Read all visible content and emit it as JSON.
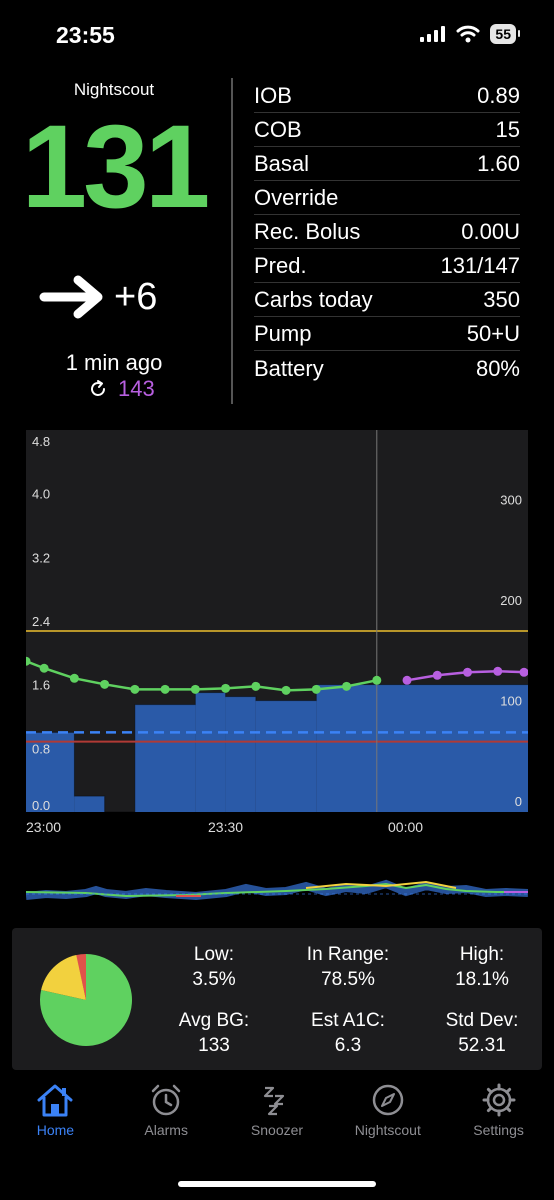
{
  "status_bar": {
    "time": "23:55",
    "battery": "55"
  },
  "glucose": {
    "app_name": "Nightscout",
    "value": "131",
    "delta": "+6",
    "age": "1 min ago",
    "predicted": "143",
    "color": "#5fd160",
    "predicted_color": "#b85fe0"
  },
  "info": {
    "rows": [
      {
        "label": "IOB",
        "value": "0.89"
      },
      {
        "label": "COB",
        "value": "15"
      },
      {
        "label": "Basal",
        "value": "1.60"
      },
      {
        "label": "Override",
        "value": ""
      },
      {
        "label": "Rec. Bolus",
        "value": "0.00U"
      },
      {
        "label": "Pred.",
        "value": "131/147"
      },
      {
        "label": "Carbs today",
        "value": "350"
      },
      {
        "label": "Pump",
        "value": "50+U"
      },
      {
        "label": "Battery",
        "value": "80%"
      }
    ]
  },
  "chart_data": {
    "type": "line",
    "left_axis_ticks": [
      "4.8",
      "4.0",
      "3.2",
      "2.4",
      "1.6",
      "0.8",
      "0.0"
    ],
    "right_axis_ticks": [
      "300",
      "200",
      "100",
      "0"
    ],
    "x_ticks": [
      "23:00",
      "23:30",
      "00:00"
    ],
    "left_ylim": [
      0,
      4.8
    ],
    "right_ylim": [
      0,
      380
    ],
    "high_line": 180,
    "low_line": 70,
    "scheduled_basal": 1.0,
    "now_minute": 58,
    "bg_series": {
      "color": "#5fd160",
      "x_min": [
        0,
        3,
        8,
        13,
        18,
        23,
        28,
        33,
        38,
        43,
        48,
        53,
        58
      ],
      "y": [
        150,
        143,
        133,
        127,
        122,
        122,
        122,
        123,
        125,
        121,
        122,
        125,
        131
      ]
    },
    "prediction_series": {
      "color": "#b85fe0",
      "x_min": [
        63,
        68,
        73,
        78,
        83
      ],
      "y": [
        131,
        136,
        139,
        140,
        139
      ]
    },
    "basal_steps": [
      {
        "from": 0,
        "to": 8,
        "rate": 1.0
      },
      {
        "from": 8,
        "to": 13,
        "rate": 0.2
      },
      {
        "from": 13,
        "to": 18,
        "rate": 0.0
      },
      {
        "from": 18,
        "to": 28,
        "rate": 1.35
      },
      {
        "from": 28,
        "to": 33,
        "rate": 1.5
      },
      {
        "from": 33,
        "to": 38,
        "rate": 1.45
      },
      {
        "from": 38,
        "to": 48,
        "rate": 1.4
      },
      {
        "from": 48,
        "to": 58,
        "rate": 1.6
      },
      {
        "from": 58,
        "to": 83,
        "rate": 1.6
      }
    ]
  },
  "stats": {
    "low_label": "Low:",
    "low_value": "3.5%",
    "in_range_label": "In Range:",
    "in_range_value": "78.5%",
    "high_label": "High:",
    "high_value": "18.1%",
    "avg_label": "Avg BG:",
    "avg_value": "133",
    "a1c_label": "Est A1C:",
    "a1c_value": "6.3",
    "std_label": "Std Dev:",
    "std_value": "52.31",
    "pie": [
      {
        "name": "Low",
        "percent": 3.5,
        "color": "#e0524a"
      },
      {
        "name": "In Range",
        "percent": 78.5,
        "color": "#5fd160"
      },
      {
        "name": "High",
        "percent": 18.1,
        "color": "#f2d13e"
      }
    ]
  },
  "tabs": [
    {
      "label": "Home",
      "icon": "home-icon",
      "active": true
    },
    {
      "label": "Alarms",
      "icon": "alarm-clock-icon",
      "active": false
    },
    {
      "label": "Snoozer",
      "icon": "zzz-icon",
      "active": false
    },
    {
      "label": "Nightscout",
      "icon": "compass-icon",
      "active": false
    },
    {
      "label": "Settings",
      "icon": "gear-icon",
      "active": false
    }
  ],
  "colors": {
    "accent": "#3b82f6",
    "basal_fill": "#2a5aa8",
    "high_line": "#b8962a",
    "low_line": "#b13a35"
  }
}
